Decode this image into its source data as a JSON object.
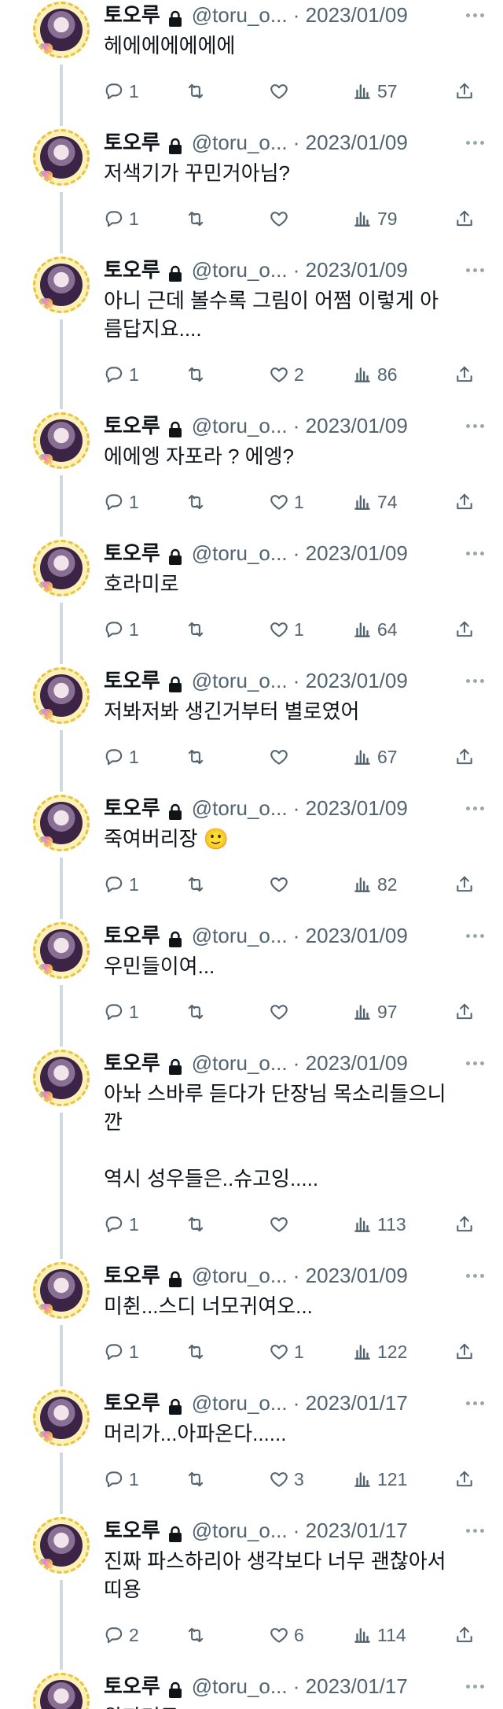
{
  "colors": {
    "text": "#0f1419",
    "muted": "#536471",
    "thread_line": "#cfd9de"
  },
  "icons": {
    "lock": "lock-icon",
    "more": "more-dots-icon",
    "reply": "reply-bubble-icon",
    "retweet": "retweet-icon",
    "like": "heart-icon",
    "views": "bar-chart-icon",
    "share": "share-upload-icon"
  },
  "tweets": [
    {
      "name": "토오루",
      "handle": "@toru_o...",
      "date": "2023/01/09",
      "text": "헤에에에에에에",
      "replies": "1",
      "retweets": "",
      "likes": "",
      "views": "57"
    },
    {
      "name": "토오루",
      "handle": "@toru_o...",
      "date": "2023/01/09",
      "text": "저색기가 꾸민거아님?",
      "replies": "1",
      "retweets": "",
      "likes": "",
      "views": "79"
    },
    {
      "name": "토오루",
      "handle": "@toru_o...",
      "date": "2023/01/09",
      "text": "아니 근데 볼수록 그림이 어쩜 이렇게 아\n름답지요....",
      "replies": "1",
      "retweets": "",
      "likes": "2",
      "views": "86"
    },
    {
      "name": "토오루",
      "handle": "@toru_o...",
      "date": "2023/01/09",
      "text": "에에엥 자포라 ? 에엥?",
      "replies": "1",
      "retweets": "",
      "likes": "1",
      "views": "74"
    },
    {
      "name": "토오루",
      "handle": "@toru_o...",
      "date": "2023/01/09",
      "text": "호라미로",
      "replies": "1",
      "retweets": "",
      "likes": "1",
      "views": "64"
    },
    {
      "name": "토오루",
      "handle": "@toru_o...",
      "date": "2023/01/09",
      "text": "저봐저봐 생긴거부터 별로였어",
      "replies": "1",
      "retweets": "",
      "likes": "",
      "views": "67"
    },
    {
      "name": "토오루",
      "handle": "@toru_o...",
      "date": "2023/01/09",
      "text": "죽여버리장 🙂",
      "replies": "1",
      "retweets": "",
      "likes": "",
      "views": "82"
    },
    {
      "name": "토오루",
      "handle": "@toru_o...",
      "date": "2023/01/09",
      "text": "우민들이여...",
      "replies": "1",
      "retweets": "",
      "likes": "",
      "views": "97"
    },
    {
      "name": "토오루",
      "handle": "@toru_o...",
      "date": "2023/01/09",
      "text": "아놔 스바루 듣다가 단장님 목소리들으니\n깐\n\n역시 성우들은..슈고잉.....",
      "replies": "1",
      "retweets": "",
      "likes": "",
      "views": "113"
    },
    {
      "name": "토오루",
      "handle": "@toru_o...",
      "date": "2023/01/09",
      "text": "미췬...스디 너모귀여오...",
      "replies": "1",
      "retweets": "",
      "likes": "1",
      "views": "122"
    },
    {
      "name": "토오루",
      "handle": "@toru_o...",
      "date": "2023/01/17",
      "text": "머리가...아파온다......",
      "replies": "1",
      "retweets": "",
      "likes": "3",
      "views": "121"
    },
    {
      "name": "토오루",
      "handle": "@toru_o...",
      "date": "2023/01/17",
      "text": "진짜 파스하리아 생각보다 너무 괜찮아서\n띠용",
      "replies": "2",
      "retweets": "",
      "likes": "6",
      "views": "114"
    },
    {
      "name": "토오루",
      "handle": "@toru_o...",
      "date": "2023/01/17",
      "text": "왕자더쿠",
      "replies": "",
      "retweets": "",
      "likes": "",
      "views": ""
    }
  ]
}
